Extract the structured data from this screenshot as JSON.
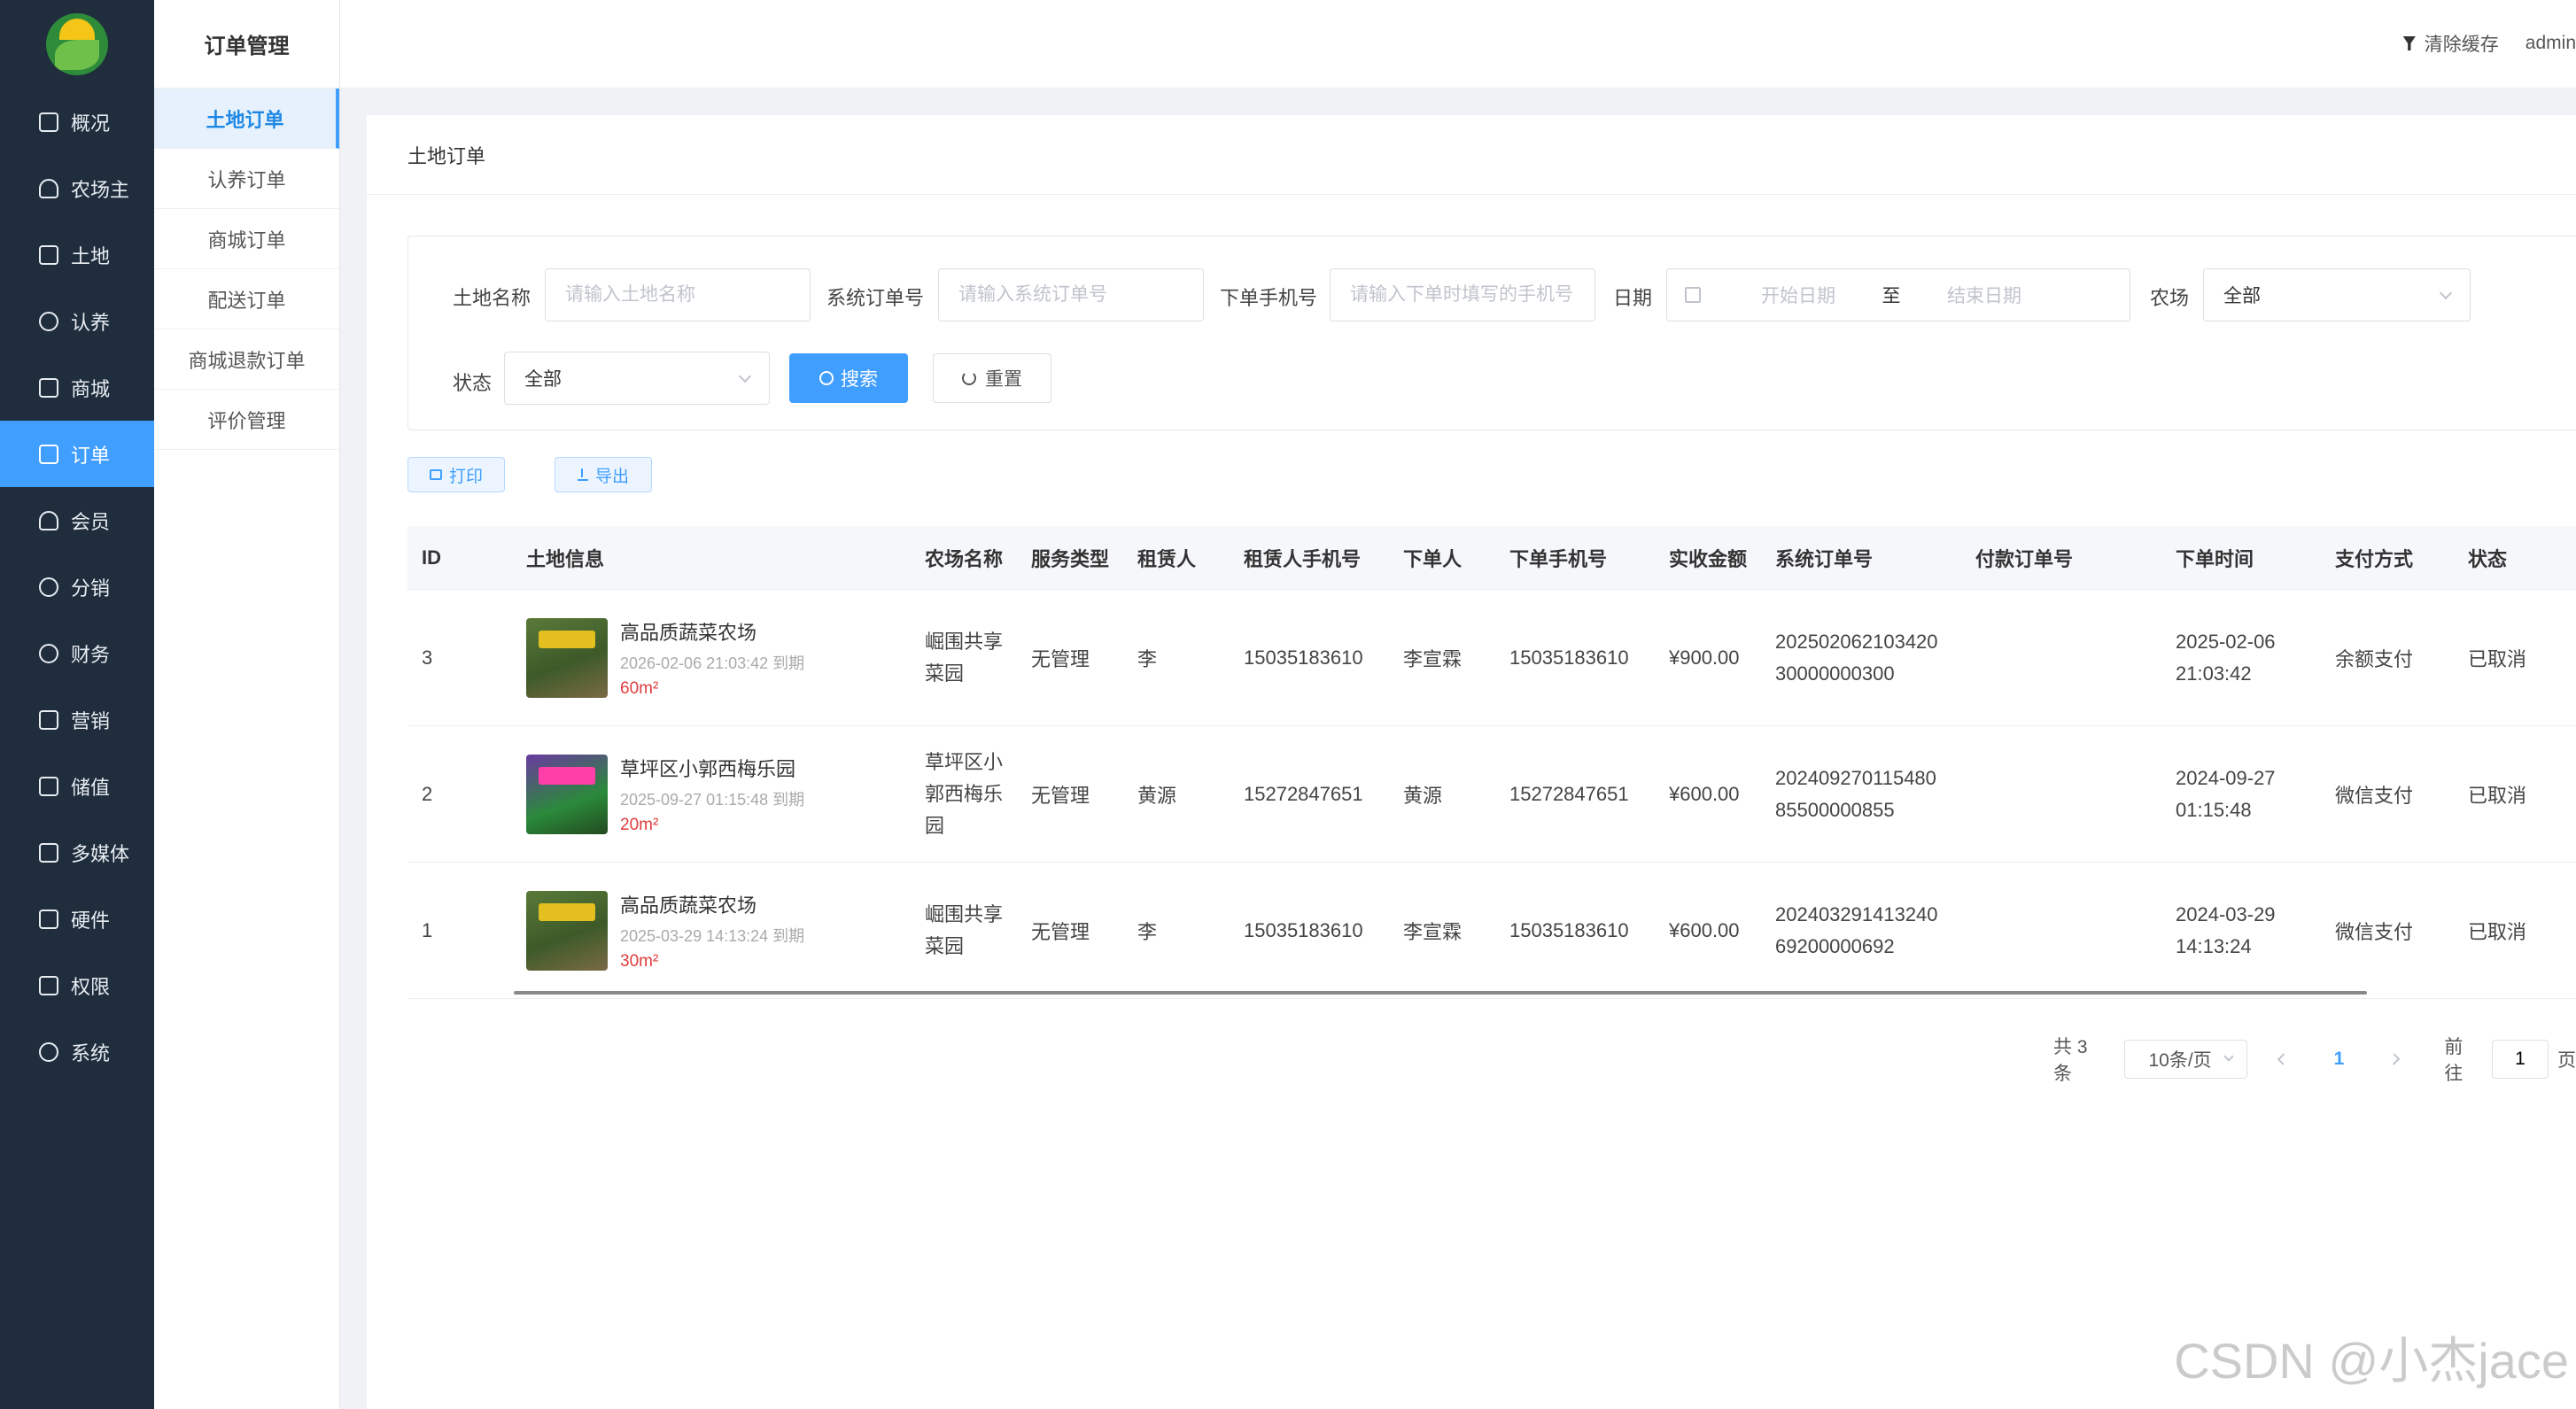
{
  "rail": {
    "items": [
      {
        "label": "概况",
        "icon": "home-icon"
      },
      {
        "label": "农场主",
        "icon": "user-icon"
      },
      {
        "label": "土地",
        "icon": "land-icon"
      },
      {
        "label": "认养",
        "icon": "refresh-icon"
      },
      {
        "label": "商城",
        "icon": "store-icon"
      },
      {
        "label": "订单",
        "icon": "order-icon"
      },
      {
        "label": "会员",
        "icon": "member-icon"
      },
      {
        "label": "分销",
        "icon": "share-icon"
      },
      {
        "label": "财务",
        "icon": "finance-icon"
      },
      {
        "label": "营销",
        "icon": "marketing-icon"
      },
      {
        "label": "储值",
        "icon": "wallet-icon"
      },
      {
        "label": "多媒体",
        "icon": "media-icon"
      },
      {
        "label": "硬件",
        "icon": "hardware-icon"
      },
      {
        "label": "权限",
        "icon": "permission-icon"
      },
      {
        "label": "系统",
        "icon": "gear-icon"
      }
    ],
    "active_index": 5
  },
  "submenu": {
    "title": "订单管理",
    "items": [
      "土地订单",
      "认养订单",
      "商城订单",
      "配送订单",
      "商城退款订单",
      "评价管理"
    ],
    "active_index": 0
  },
  "topbar": {
    "clear_cache": "清除缓存",
    "user": "admin"
  },
  "page": {
    "title": "土地订单"
  },
  "filters": {
    "land_name_label": "土地名称",
    "land_name_placeholder": "请输入土地名称",
    "order_no_label": "系统订单号",
    "order_no_placeholder": "请输入系统订单号",
    "phone_label": "下单手机号",
    "phone_placeholder": "请输入下单时填写的手机号",
    "date_label": "日期",
    "date_start": "开始日期",
    "date_sep": "至",
    "date_end": "结束日期",
    "farm_label": "农场",
    "farm_value": "全部",
    "status_label": "状态",
    "status_value": "全部",
    "search_button": "搜索",
    "reset_button": "重置"
  },
  "actions": {
    "print": "打印",
    "export": "导出"
  },
  "table": {
    "headers": [
      "ID",
      "土地信息",
      "农场名称",
      "服务类型",
      "租赁人",
      "租赁人手机号",
      "下单人",
      "下单手机号",
      "实收金额",
      "系统订单号",
      "付款订单号",
      "下单时间",
      "支付方式",
      "状态"
    ],
    "rows": [
      {
        "id": "3",
        "land_name": "高品质蔬菜农场",
        "expire": "2026-02-06 21:03:42 到期",
        "area": "60m²",
        "farm_line1": "崛围共享",
        "farm_line2": "菜园",
        "farm_line3": "",
        "service": "无管理",
        "lessee": "李",
        "lessee_phone": "15035183610",
        "orderer": "李宣霖",
        "order_phone": "15035183610",
        "amount": "¥900.00",
        "sys_no_line1": "202502062103420",
        "sys_no_line2": "30000000300",
        "pay_no": "",
        "time_line1": "2025-02-06",
        "time_line2": "21:03:42",
        "pay_method": "余额支付",
        "status": "已取消"
      },
      {
        "id": "2",
        "land_name": "草坪区小郭西梅乐园",
        "expire": "2025-09-27 01:15:48 到期",
        "area": "20m²",
        "farm_line1": "草坪区小",
        "farm_line2": "郭西梅乐",
        "farm_line3": "园",
        "service": "无管理",
        "lessee": "黄源",
        "lessee_phone": "15272847651",
        "orderer": "黄源",
        "order_phone": "15272847651",
        "amount": "¥600.00",
        "sys_no_line1": "202409270115480",
        "sys_no_line2": "85500000855",
        "pay_no": "",
        "time_line1": "2024-09-27",
        "time_line2": "01:15:48",
        "pay_method": "微信支付",
        "status": "已取消"
      },
      {
        "id": "1",
        "land_name": "高品质蔬菜农场",
        "expire": "2025-03-29 14:13:24 到期",
        "area": "30m²",
        "farm_line1": "崛围共享",
        "farm_line2": "菜园",
        "farm_line3": "",
        "service": "无管理",
        "lessee": "李",
        "lessee_phone": "15035183610",
        "orderer": "李宣霖",
        "order_phone": "15035183610",
        "amount": "¥600.00",
        "sys_no_line1": "202403291413240",
        "sys_no_line2": "69200000692",
        "pay_no": "",
        "time_line1": "2024-03-29",
        "time_line2": "14:13:24",
        "pay_method": "微信支付",
        "status": "已取消"
      }
    ]
  },
  "pagination": {
    "total": "共 3 条",
    "page_size": "10条/页",
    "current": "1",
    "goto_label": "前往",
    "goto_value": "1",
    "page_suffix": "页"
  },
  "watermark": "CSDN @小杰jace"
}
